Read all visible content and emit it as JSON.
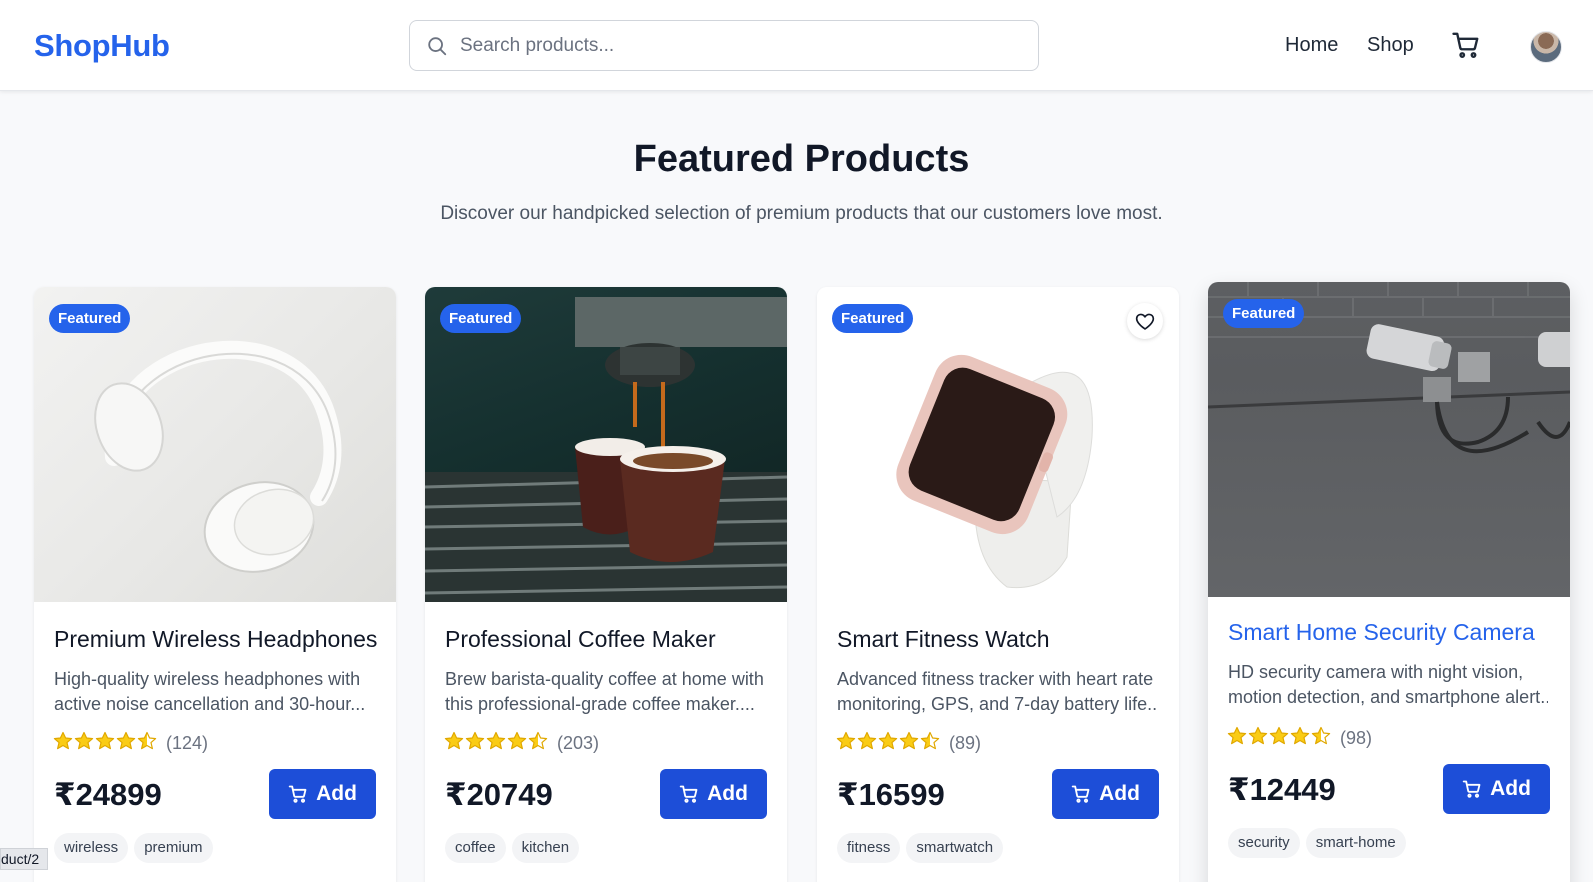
{
  "header": {
    "logo": "ShopHub",
    "search_placeholder": "Search products...",
    "nav": [
      "Home",
      "Shop"
    ]
  },
  "hero": {
    "title": "Featured Products",
    "subtitle": "Discover our handpicked selection of premium products that our customers love most."
  },
  "products": [
    {
      "badge": "Featured",
      "title": "Premium Wireless Headphones",
      "desc_line1": "High-quality wireless headphones with",
      "desc_line2": "active noise cancellation and 30-hour...",
      "rating": 4.5,
      "reviews": "(124)",
      "price": "₹24899",
      "add_label": "Add",
      "tags": [
        "wireless",
        "premium"
      ]
    },
    {
      "badge": "Featured",
      "title": "Professional Coffee Maker",
      "desc_line1": "Brew barista-quality coffee at home with",
      "desc_line2": "this professional-grade coffee maker....",
      "rating": 4.5,
      "reviews": "(203)",
      "price": "₹20749",
      "add_label": "Add",
      "tags": [
        "coffee",
        "kitchen"
      ]
    },
    {
      "badge": "Featured",
      "title": "Smart Fitness Watch",
      "desc_line1": "Advanced fitness tracker with heart rate",
      "desc_line2": "monitoring, GPS, and 7-day battery life....",
      "rating": 4.5,
      "reviews": "(89)",
      "price": "₹16599",
      "add_label": "Add",
      "tags": [
        "fitness",
        "smartwatch"
      ]
    },
    {
      "badge": "Featured",
      "title": "Smart Home Security Camera",
      "desc_line1": "HD security camera with night vision,",
      "desc_line2": "motion detection, and smartphone alert...",
      "rating": 4.5,
      "reviews": "(98)",
      "price": "₹12449",
      "add_label": "Add",
      "tags": [
        "security",
        "smart-home"
      ]
    }
  ],
  "status_bar": "duct/2",
  "colors": {
    "accent": "#2563eb",
    "button": "#1d4ed8",
    "star": "#facc15",
    "hover_title": "#2563eb"
  }
}
